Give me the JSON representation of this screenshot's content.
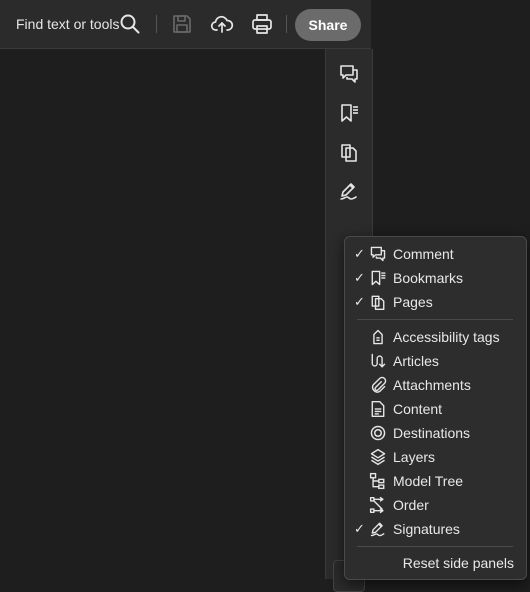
{
  "toolbar": {
    "find_label": "Find text or tools",
    "share_label": "Share",
    "icons": [
      "search-icon",
      "save-icon",
      "upload-cloud-icon",
      "print-icon"
    ]
  },
  "rail": {
    "icons": [
      "comment-icon",
      "bookmarks-icon",
      "pages-icon",
      "signatures-icon"
    ]
  },
  "menu": {
    "items": [
      {
        "label": "Comment",
        "checked": true,
        "icon": "comment-icon"
      },
      {
        "label": "Bookmarks",
        "checked": true,
        "icon": "bookmarks-icon"
      },
      {
        "label": "Pages",
        "checked": true,
        "icon": "pages-icon"
      },
      {
        "label": "Accessibility tags",
        "checked": false,
        "icon": "accessibility-tags-icon"
      },
      {
        "label": "Articles",
        "checked": false,
        "icon": "articles-icon"
      },
      {
        "label": "Attachments",
        "checked": false,
        "icon": "attachments-icon"
      },
      {
        "label": "Content",
        "checked": false,
        "icon": "content-icon"
      },
      {
        "label": "Destinations",
        "checked": false,
        "icon": "destinations-icon"
      },
      {
        "label": "Layers",
        "checked": false,
        "icon": "layers-icon"
      },
      {
        "label": "Model Tree",
        "checked": false,
        "icon": "model-tree-icon"
      },
      {
        "label": "Order",
        "checked": false,
        "icon": "order-icon"
      },
      {
        "label": "Signatures",
        "checked": true,
        "icon": "signatures-icon"
      }
    ],
    "check_mark": "✓",
    "reset_label": "Reset side panels"
  },
  "colors": {
    "background": "#1e1e1e",
    "toolbar": "#2b2b2b",
    "share_button": "#6b6b6b",
    "menu": "#2d2d2d",
    "text": "#e8e8e8"
  }
}
